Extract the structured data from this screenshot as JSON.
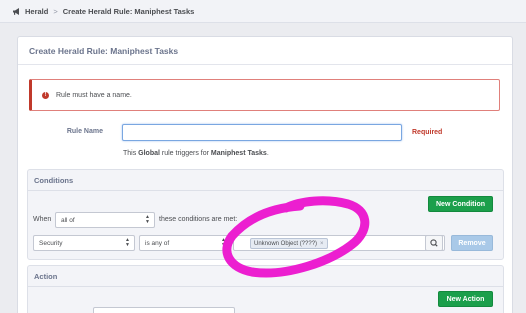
{
  "breadcrumbs": {
    "root": "Herald",
    "separator": ">",
    "current": "Create Herald Rule: Maniphest Tasks"
  },
  "panel": {
    "title": "Create Herald Rule: Maniphest Tasks"
  },
  "error": {
    "icon": "exclamation-circle-icon",
    "message": "Rule must have a name."
  },
  "form": {
    "rule_name_label": "Rule Name",
    "rule_name_value": "",
    "required_label": "Required",
    "description": {
      "prefix": "This ",
      "scope": "Global",
      "middle": " rule triggers for ",
      "object": "Maniphest Tasks",
      "suffix": "."
    }
  },
  "conditions": {
    "header": "Conditions",
    "new_button": "New Condition",
    "when_label": "When",
    "match_mode": "all of",
    "match_suffix": "these conditions are met:",
    "row": {
      "field": "Security",
      "operator": "is any of",
      "token": "Unknown Object (????)",
      "token_remove": "×",
      "remove_button": "Remove"
    }
  },
  "actions": {
    "header": "Action",
    "new_button": "New Action"
  },
  "colors": {
    "accent_green": "#1b9f4b",
    "error_red": "#c0392b",
    "scribble_magenta": "#ec1fd0"
  }
}
